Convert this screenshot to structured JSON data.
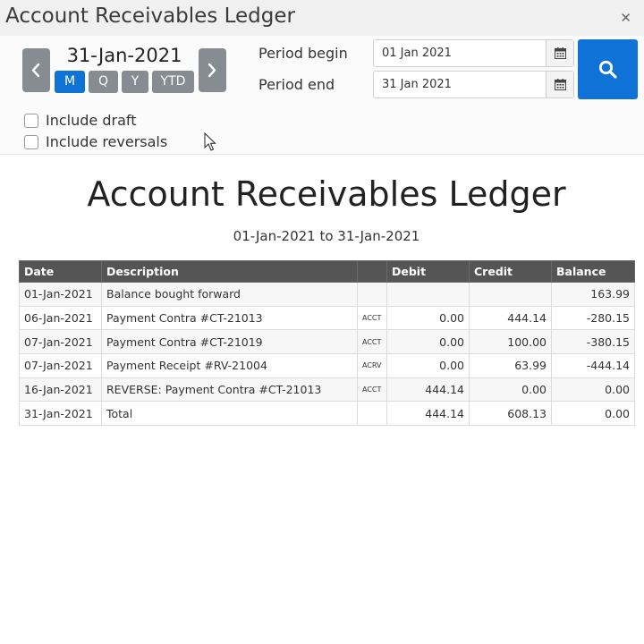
{
  "window": {
    "title": "Account Receivables Ledger",
    "close_icon": "close-icon"
  },
  "period_selector": {
    "current_date": "31-Jan-2021",
    "buttons": [
      {
        "label": "M",
        "active": true
      },
      {
        "label": "Q",
        "active": false
      },
      {
        "label": "Y",
        "active": false
      },
      {
        "label": "YTD",
        "active": false
      }
    ]
  },
  "filters": {
    "period_begin_label": "Period begin",
    "period_begin_value": "01 Jan 2021",
    "period_end_label": "Period end",
    "period_end_value": "31 Jan 2021",
    "include_draft_label": "Include draft",
    "include_draft_checked": false,
    "include_reversals_label": "Include reversals",
    "include_reversals_checked": false
  },
  "colors": {
    "primary": "#0f72d6",
    "nav_gray": "#878c93",
    "header_dark": "#555555"
  },
  "report": {
    "title": "Account Receivables Ledger",
    "subtitle": "01-Jan-2021 to 31-Jan-2021",
    "columns": [
      "Date",
      "Description",
      "",
      "Debit",
      "Credit",
      "Balance"
    ],
    "rows": [
      [
        "01-Jan-2021",
        "Balance bought forward",
        "",
        "",
        "",
        "163.99"
      ],
      [
        "06-Jan-2021",
        "Payment Contra #CT-21013",
        "ACCT",
        "0.00",
        "444.14",
        "-280.15"
      ],
      [
        "07-Jan-2021",
        "Payment Contra #CT-21019",
        "ACCT",
        "0.00",
        "100.00",
        "-380.15"
      ],
      [
        "07-Jan-2021",
        "Payment Receipt #RV-21004",
        "ACRV",
        "0.00",
        "63.99",
        "-444.14"
      ],
      [
        "16-Jan-2021",
        "REVERSE: Payment Contra #CT-21013",
        "ACCT",
        "444.14",
        "0.00",
        "0.00"
      ],
      [
        "31-Jan-2021",
        "Total",
        "",
        "444.14",
        "608.13",
        "0.00"
      ]
    ]
  }
}
